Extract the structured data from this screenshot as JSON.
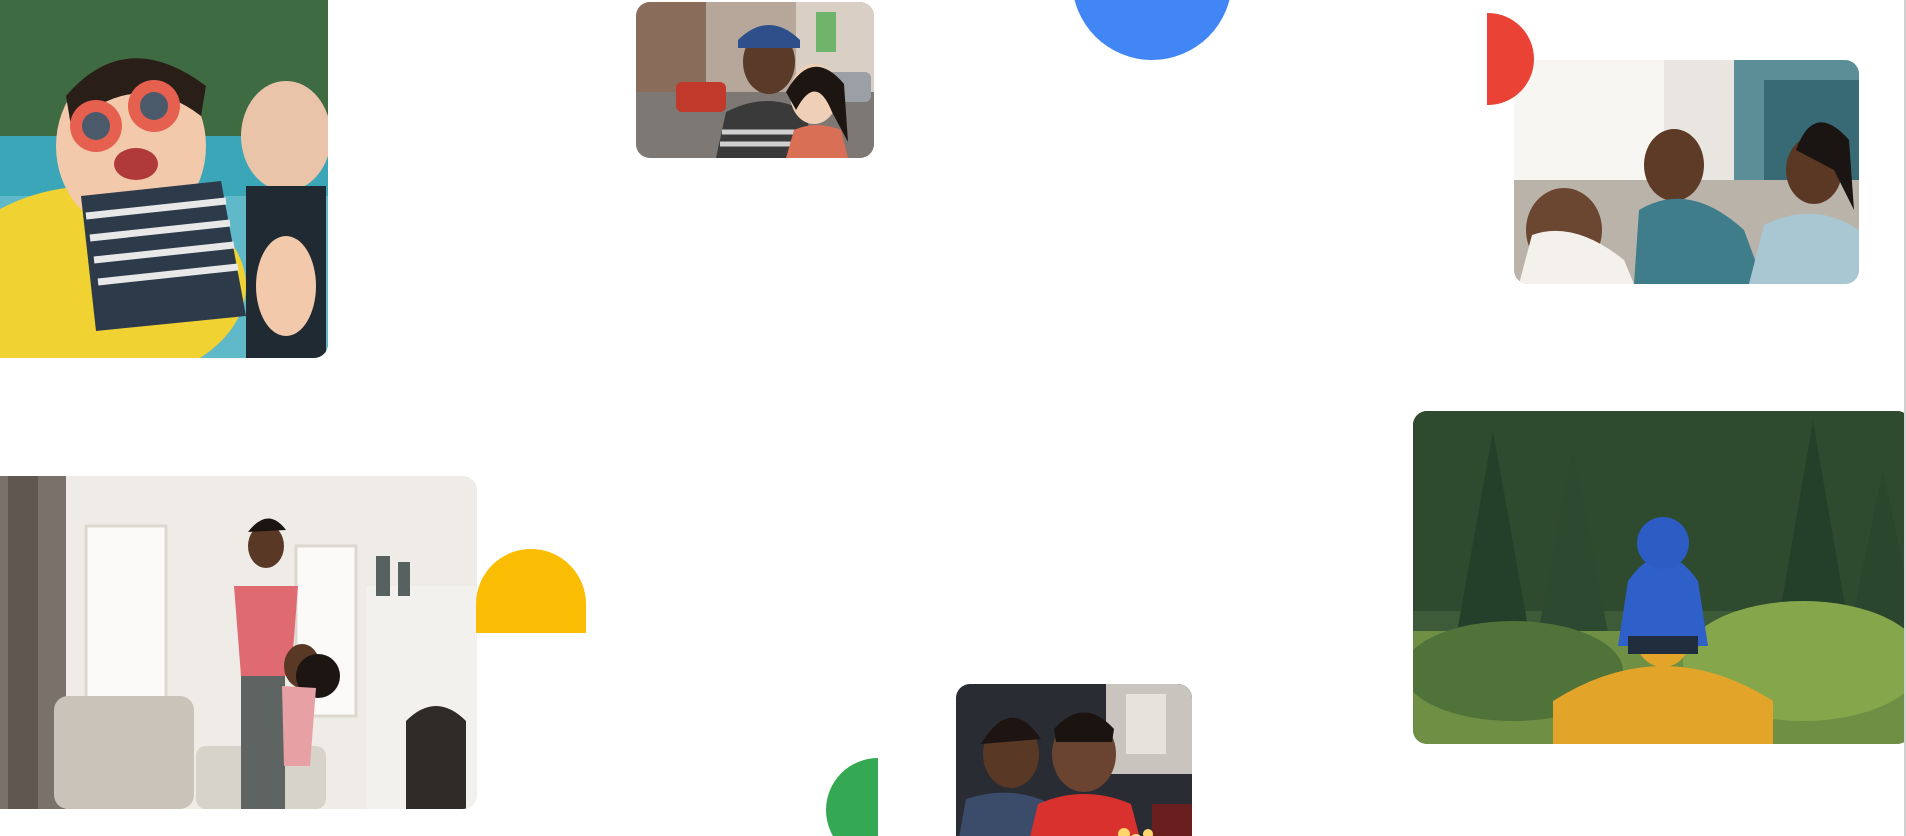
{
  "page": {
    "background": "#ffffff"
  },
  "accent_colors": {
    "blue": "#4285F4",
    "red": "#EA4335",
    "yellow": "#FBBC04",
    "green": "#34A853"
  },
  "photos": [
    {
      "name": "girl-pool-sunglasses",
      "subject": ""
    },
    {
      "name": "couple-street",
      "subject": ""
    },
    {
      "name": "family-couch-laughing",
      "subject": ""
    },
    {
      "name": "mother-daughter-living-room",
      "subject": ""
    },
    {
      "name": "father-child-forest",
      "subject": ""
    },
    {
      "name": "boy-birthday-candles",
      "subject": ""
    }
  ]
}
